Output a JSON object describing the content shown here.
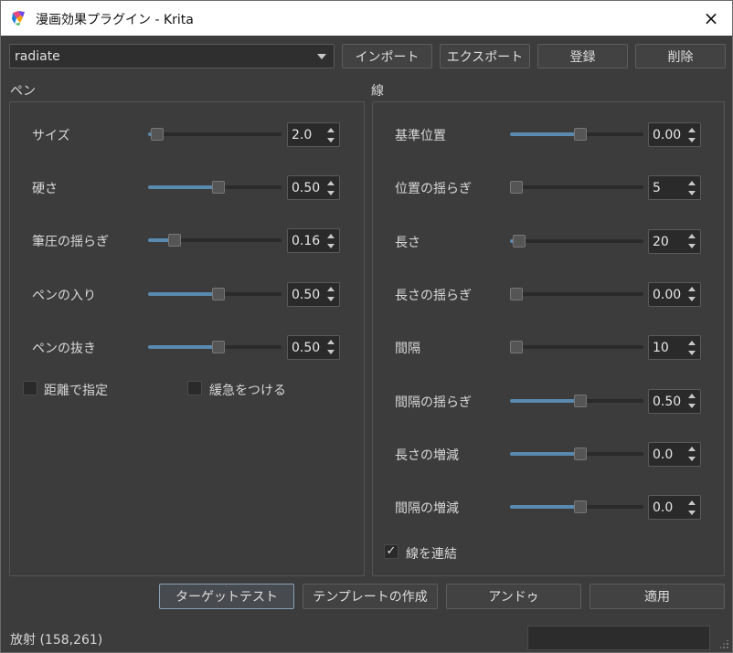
{
  "window": {
    "title": "漫画効果プラグイン - Krita",
    "close_icon": "×"
  },
  "preset": {
    "selected": "radiate"
  },
  "toolbar": {
    "import_label": "インポート",
    "export_label": "エクスポート",
    "register_label": "登録",
    "delete_label": "削除"
  },
  "pen": {
    "label": "ペン",
    "rows": [
      {
        "label": "サイズ",
        "value": "2.0",
        "level": 0.02
      },
      {
        "label": "硬さ",
        "value": "0.50",
        "level": 0.5
      },
      {
        "label": "筆圧の揺らぎ",
        "value": "0.16",
        "level": 0.16
      },
      {
        "label": "ペンの入り",
        "value": "0.50",
        "level": 0.5
      },
      {
        "label": "ペンの抜き",
        "value": "0.50",
        "level": 0.5
      }
    ],
    "checks": [
      {
        "label": "距離で指定",
        "checked": false
      },
      {
        "label": "緩急をつける",
        "checked": false
      }
    ]
  },
  "line": {
    "label": "線",
    "rows": [
      {
        "label": "基準位置",
        "value": "0.00",
        "level": 0.5
      },
      {
        "label": "位置の揺らぎ",
        "value": "5",
        "level": 0.0
      },
      {
        "label": "長さ",
        "value": "20",
        "level": 0.02
      },
      {
        "label": "長さの揺らぎ",
        "value": "0.00",
        "level": 0.0
      },
      {
        "label": "間隔",
        "value": "10",
        "level": 0.0
      },
      {
        "label": "間隔の揺らぎ",
        "value": "0.50",
        "level": 0.5
      },
      {
        "label": "長さの増減",
        "value": "0.0",
        "level": 0.5
      },
      {
        "label": "間隔の増減",
        "value": "0.0",
        "level": 0.5
      }
    ],
    "connect": {
      "label": "線を連結",
      "checked": true,
      "mark": "✓"
    }
  },
  "actions": {
    "target_test": "ターゲットテスト",
    "create_template": "テンプレートの作成",
    "undo": "アンドゥ",
    "apply": "適用"
  },
  "status": {
    "text": "放射 (158,261)"
  },
  "colors": {
    "accent": "#5a8ab0",
    "background": "#3c3c3c",
    "titlebar": "#ffffff"
  }
}
